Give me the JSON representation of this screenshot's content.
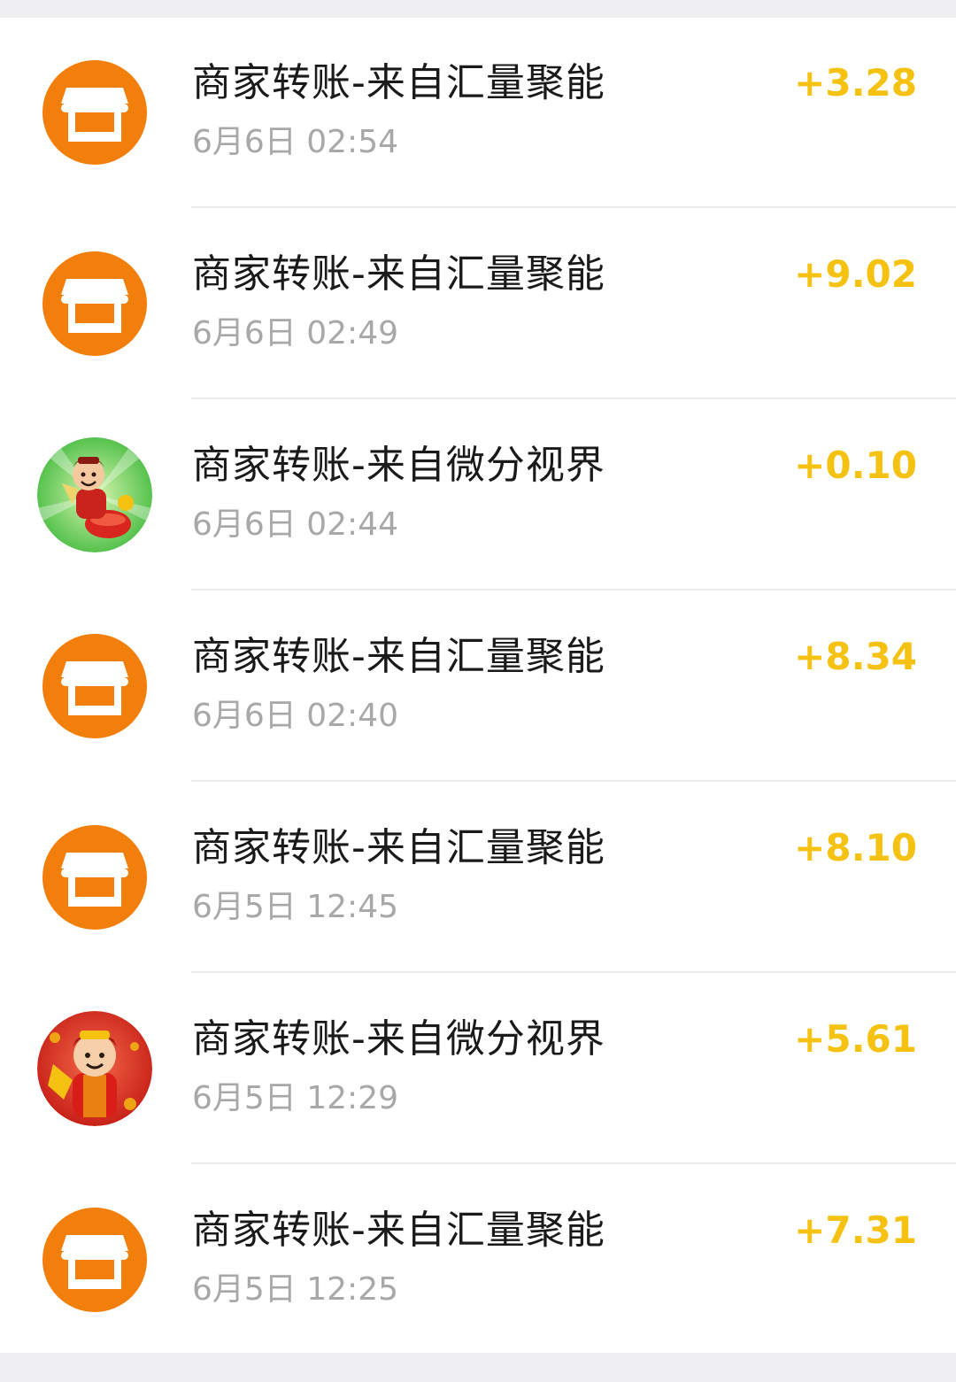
{
  "colors": {
    "background": "#efeff1",
    "card": "#ffffff",
    "title_text": "#1a1a1a",
    "time_text": "#a8a8a8",
    "amount_text": "#f5c211",
    "store_icon_bg": "#f27f0c"
  },
  "transactions": [
    {
      "icon": "store-icon",
      "title": "商家转账-来自汇量聚能",
      "time": "6月6日 02:54",
      "amount": "+3.28"
    },
    {
      "icon": "store-icon",
      "title": "商家转账-来自汇量聚能",
      "time": "6月6日 02:49",
      "amount": "+9.02"
    },
    {
      "icon": "fortune-god-avatar",
      "title": "商家转账-来自微分视界",
      "time": "6月6日 02:44",
      "amount": "+0.10"
    },
    {
      "icon": "store-icon",
      "title": "商家转账-来自汇量聚能",
      "time": "6月6日 02:40",
      "amount": "+8.34"
    },
    {
      "icon": "store-icon",
      "title": "商家转账-来自汇量聚能",
      "time": "6月5日 12:45",
      "amount": "+8.10"
    },
    {
      "icon": "fortune-god-avatar",
      "title": "商家转账-来自微分视界",
      "time": "6月5日 12:29",
      "amount": "+5.61"
    },
    {
      "icon": "store-icon",
      "title": "商家转账-来自汇量聚能",
      "time": "6月5日 12:25",
      "amount": "+7.31"
    }
  ]
}
